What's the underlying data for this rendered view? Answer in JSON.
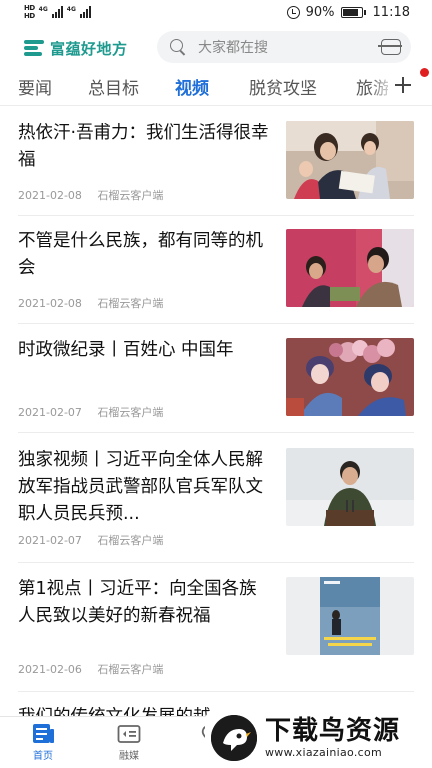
{
  "status_bar": {
    "hd_top": "HD",
    "hd_bottom": "HD",
    "net_1": "4G",
    "net_2": "4G",
    "battery": "90%",
    "time": "11:18"
  },
  "header": {
    "app_name": "富蕴好地方",
    "search_placeholder": "大家都在搜",
    "brand_color": "#1f9a8f"
  },
  "tabs": {
    "items": [
      "要闻",
      "总目标",
      "视频",
      "脱贫攻坚"
    ],
    "clipped": "旅游",
    "active": "视频",
    "active_color": "#1f6fd9"
  },
  "news": [
    {
      "title": "热依汗·吾甫力：我们生活得很幸福",
      "date": "2021-02-08",
      "source": "石榴云客户端",
      "thumb": "family-reading-photo"
    },
    {
      "title": "不管是什么民族，都有同等的机会",
      "date": "2021-02-08",
      "source": "石榴云客户端",
      "thumb": "mother-child-photo"
    },
    {
      "title": "时政微纪录丨百姓心 中国年",
      "date": "2021-02-07",
      "source": "石榴云客户端",
      "thumb": "opera-performers-photo"
    },
    {
      "title": "独家视频丨习近平向全体人民解放军指战员武警部队官兵军队文职人员民兵预...",
      "date": "2021-02-07",
      "source": "石榴云客户端",
      "thumb": "speech-podium-photo"
    },
    {
      "title": "第1视点丨习近平：向全国各族人民致以美好的新春祝福",
      "date": "2021-02-06",
      "source": "石榴云客户端",
      "thumb": "video-poster-photo"
    },
    {
      "title": "我们的传统文化发展的越来",
      "date": "",
      "source": "",
      "thumb": ""
    }
  ],
  "bottom_nav": {
    "items": [
      "首页",
      "融媒",
      "服"
    ]
  },
  "watermark": {
    "title": "下载鸟资源",
    "url": "www.xiazainiao.com"
  }
}
